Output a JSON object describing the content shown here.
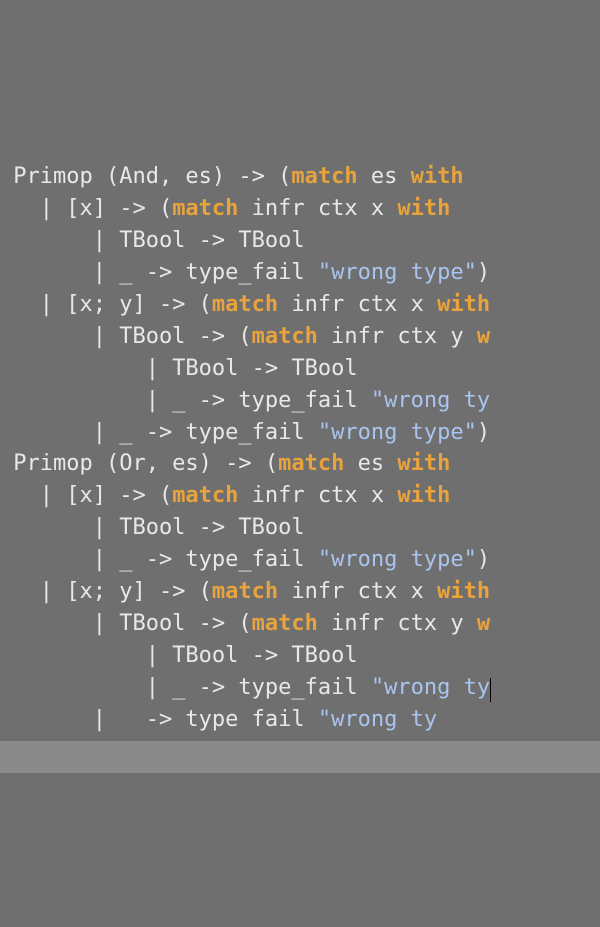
{
  "kw_match": "match",
  "kw_with": "with",
  "lines": {
    "l0a": " Primop (And, es) -> (",
    "l0b": " es ",
    "l1a": "   | [x] -> (",
    "l1b": " infr ctx x ",
    "l2": "       | TBool -> TBool",
    "l3a": "       | _ -> type_fail ",
    "l3b": "\"wrong type\"",
    "l3c": ")",
    "l4a": "   | [x; y] -> (",
    "l4b": " infr ctx x ",
    "l5a": "       | TBool -> (",
    "l5b": " infr ctx y ",
    "l5c": "w",
    "l6": "           | TBool -> TBool",
    "l7a": "           | _ -> type_fail ",
    "l7b": "\"wrong ty",
    "l8a": "       | _ -> type_fail ",
    "l8b": "\"wrong type\"",
    "l8c": ")",
    "l9a": " Primop (Or, es) -> (",
    "l9b": " es ",
    "l10a": "   | [x] -> (",
    "l10b": " infr ctx x ",
    "l11": "       | TBool -> TBool",
    "l12a": "       | _ -> type_fail ",
    "l12b": "\"wrong type\"",
    "l12c": ")",
    "l13a": "   | [x; y] -> (",
    "l13b": " infr ctx x ",
    "l14a": "       | TBool -> (",
    "l14b": " infr ctx y ",
    "l14c": "w",
    "l15": "           | TBool -> TBool",
    "l16a": "           | _ -> type_fail ",
    "l16b": "\"wrong ty",
    "l17a": "       |   -> type fail ",
    "l17b": "\"wrong ty"
  }
}
